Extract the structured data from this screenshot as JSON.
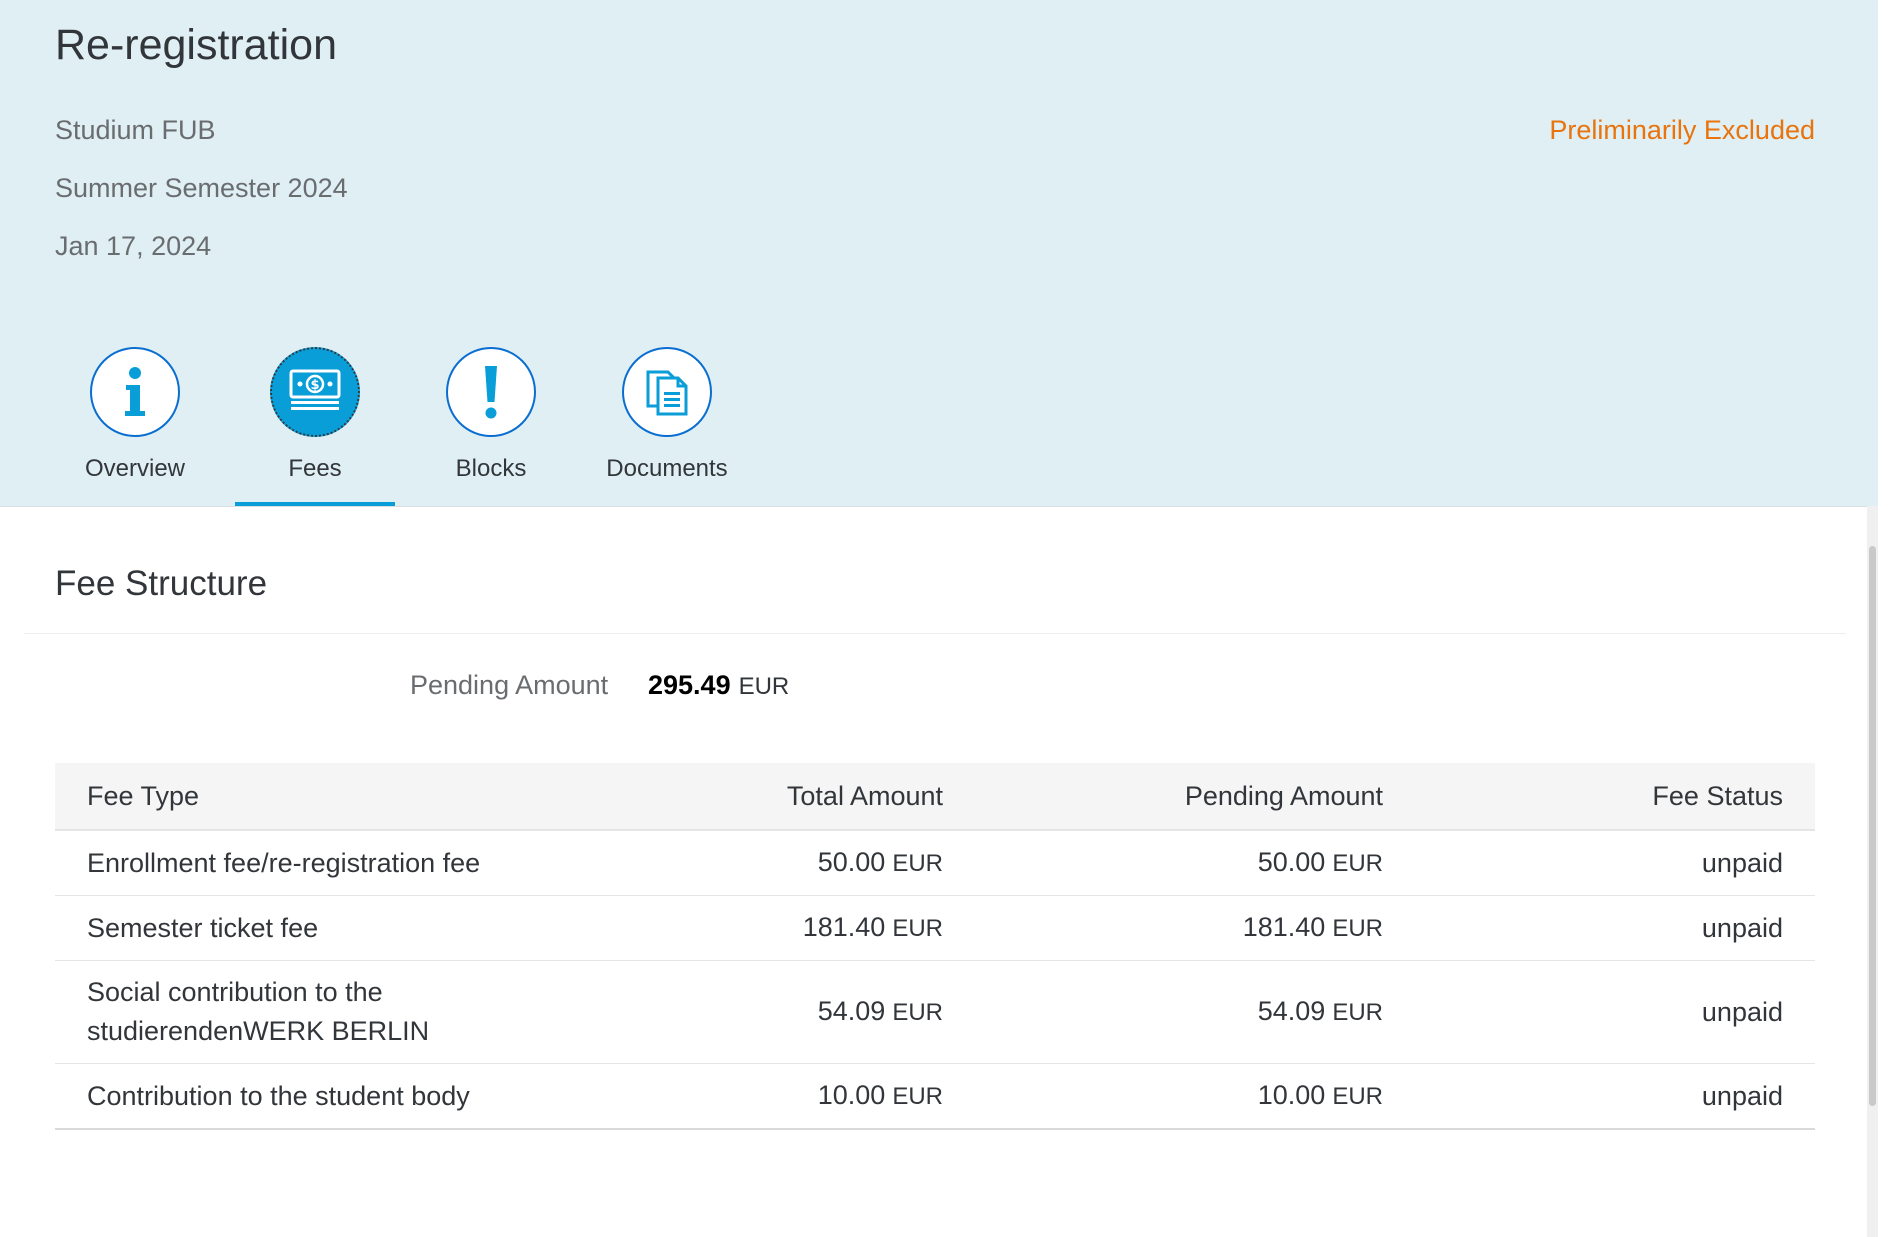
{
  "header": {
    "title": "Re-registration",
    "program": "Studium FUB",
    "semester": "Summer Semester 2024",
    "date": "Jan 17, 2024",
    "status": "Preliminarily Excluded",
    "status_color": "#e9730c"
  },
  "tabs": [
    {
      "label": "Overview",
      "icon": "info-icon",
      "active": false
    },
    {
      "label": "Fees",
      "icon": "money-icon",
      "active": true
    },
    {
      "label": "Blocks",
      "icon": "exclamation-icon",
      "active": false
    },
    {
      "label": "Documents",
      "icon": "documents-icon",
      "active": false
    }
  ],
  "fee_structure": {
    "title": "Fee Structure",
    "pending_label": "Pending Amount",
    "pending_value": "295.49",
    "pending_currency": "EUR",
    "columns": [
      "Fee Type",
      "Total Amount",
      "Pending Amount",
      "Fee Status"
    ],
    "rows": [
      {
        "type": "Enrollment fee/re-registration fee",
        "total": "50.00",
        "total_cur": "EUR",
        "pending": "50.00",
        "pending_cur": "EUR",
        "status": "unpaid"
      },
      {
        "type": "Semester ticket fee",
        "total": "181.40",
        "total_cur": "EUR",
        "pending": "181.40",
        "pending_cur": "EUR",
        "status": "unpaid"
      },
      {
        "type": "Social contribution to the studierendenWERK BERLIN",
        "total": "54.09",
        "total_cur": "EUR",
        "pending": "54.09",
        "pending_cur": "EUR",
        "status": "unpaid"
      },
      {
        "type": "Contribution to the student body",
        "total": "10.00",
        "total_cur": "EUR",
        "pending": "10.00",
        "pending_cur": "EUR",
        "status": "unpaid"
      }
    ]
  },
  "colors": {
    "header_bg": "#dfeff3",
    "accent": "#0a9ed9",
    "icon_blue": "#0a6ed1"
  }
}
